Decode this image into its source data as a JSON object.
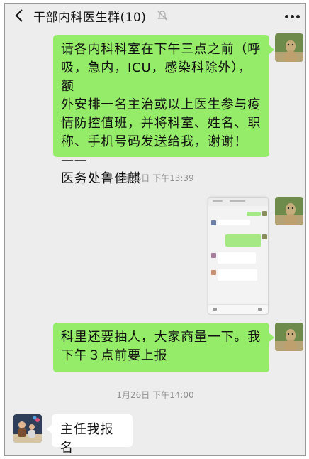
{
  "header": {
    "title": "干部内科医生群(10)",
    "back_icon": "chevron-left-icon",
    "mute_icon": "bell-muted-icon",
    "more_icon": "more-dots-icon"
  },
  "messages": [
    {
      "sender": "self",
      "text": [
        "请各内科科室在下午三点之前（呼",
        "吸，急内，ICU，感染科除外），额",
        "外安排一名主治或以上医生参与疫",
        "情防控值班，并将科室、姓名、职",
        "称、手机号码发送给我，谢谢！——",
        "医务处鲁佳麒"
      ]
    },
    {
      "timestamp": "1月26日 下午13:39"
    },
    {
      "sender": "self",
      "type": "image"
    },
    {
      "sender": "self",
      "text": [
        "科里还要抽人，大家商量一下。我",
        "下午３点前要上报"
      ]
    },
    {
      "timestamp": "1月26日 下午14:00"
    },
    {
      "sender": "other",
      "text": [
        "主任我报名"
      ]
    }
  ],
  "colors": {
    "background": "#ededed",
    "bubble_self": "#95ec69",
    "bubble_other": "#ffffff",
    "timestamp": "#8f8f8f"
  }
}
